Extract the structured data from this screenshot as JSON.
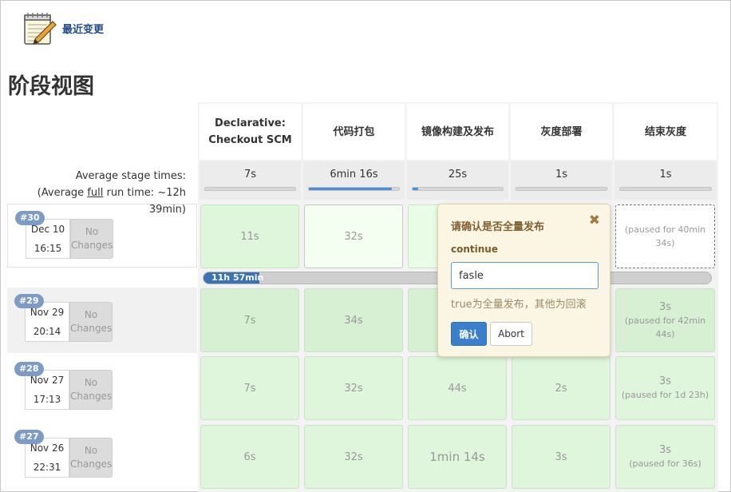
{
  "header": {
    "changes_label": "最近变更",
    "changes_icon": "notepad-pencil-icon"
  },
  "page_title": "阶段视图",
  "stages": [
    {
      "name_line1": "Declarative:",
      "name_line2": "Checkout SCM",
      "avg": "7s",
      "avg_fraction": 0.0
    },
    {
      "name_line1": "代码打包",
      "name_line2": "",
      "avg": "6min 16s",
      "avg_fraction": 0.92
    },
    {
      "name_line1": "镜像构建及发布",
      "name_line2": "",
      "avg": "25s",
      "avg_fraction": 0.06
    },
    {
      "name_line1": "灰度部署",
      "name_line2": "",
      "avg": "1s",
      "avg_fraction": 0.0
    },
    {
      "name_line1": "结束灰度",
      "name_line2": "",
      "avg": "1s",
      "avg_fraction": 0.0
    }
  ],
  "average": {
    "line1": "Average stage times:",
    "line2_pre": "(Average ",
    "line2_link": "full",
    "line2_post": " run time: ~12h",
    "line3": "39min)"
  },
  "runs": [
    {
      "id": "#30",
      "date": "Dec 10",
      "time": "16:15",
      "changes_line1": "No",
      "changes_line2": "Changes",
      "cells": [
        {
          "value": "11s",
          "note": ""
        },
        {
          "value": "32s",
          "note": ""
        },
        {
          "value": "",
          "note": ""
        },
        {
          "value": "",
          "note": ""
        },
        {
          "value": "",
          "note": "(paused for 40min 34s)"
        }
      ]
    },
    {
      "id": "#29",
      "date": "Nov 29",
      "time": "20:14",
      "changes_line1": "No",
      "changes_line2": "Changes",
      "cells": [
        {
          "value": "7s",
          "note": ""
        },
        {
          "value": "34s",
          "note": ""
        },
        {
          "value": "",
          "note": ""
        },
        {
          "value": "",
          "note": ""
        },
        {
          "value": "3s",
          "note": "(paused for 42min 44s)"
        }
      ]
    },
    {
      "id": "#28",
      "date": "Nov 27",
      "time": "17:13",
      "changes_line1": "No",
      "changes_line2": "Changes",
      "cells": [
        {
          "value": "7s",
          "note": ""
        },
        {
          "value": "32s",
          "note": ""
        },
        {
          "value": "44s",
          "note": ""
        },
        {
          "value": "2s",
          "note": ""
        },
        {
          "value": "3s",
          "note": "(paused for 1d 23h)"
        }
      ]
    },
    {
      "id": "#27",
      "date": "Nov 26",
      "time": "22:31",
      "changes_line1": "No",
      "changes_line2": "Changes",
      "cells": [
        {
          "value": "6s",
          "note": ""
        },
        {
          "value": "32s",
          "note": ""
        },
        {
          "value": "1min 14s",
          "note": ""
        },
        {
          "value": "3s",
          "note": ""
        },
        {
          "value": "3s",
          "note": "(paused for 36s)"
        }
      ]
    }
  ],
  "progress": {
    "label": "11h 57min",
    "fraction": 0.11
  },
  "input_dialog": {
    "title": "请确认是否全量发布",
    "close_icon": "close-icon",
    "param_name": "continue",
    "value": "fasle",
    "help": "true为全量发布，其他为回滚",
    "ok_label": "确认",
    "abort_label": "Abort"
  },
  "colors": {
    "link": "#204a87",
    "badge": "#7d9bc4",
    "success_cell": "#dff5dc",
    "progress": "#3973b3",
    "confirm_button": "#3a7fcc",
    "popover_bg": "#fbf5e3"
  }
}
